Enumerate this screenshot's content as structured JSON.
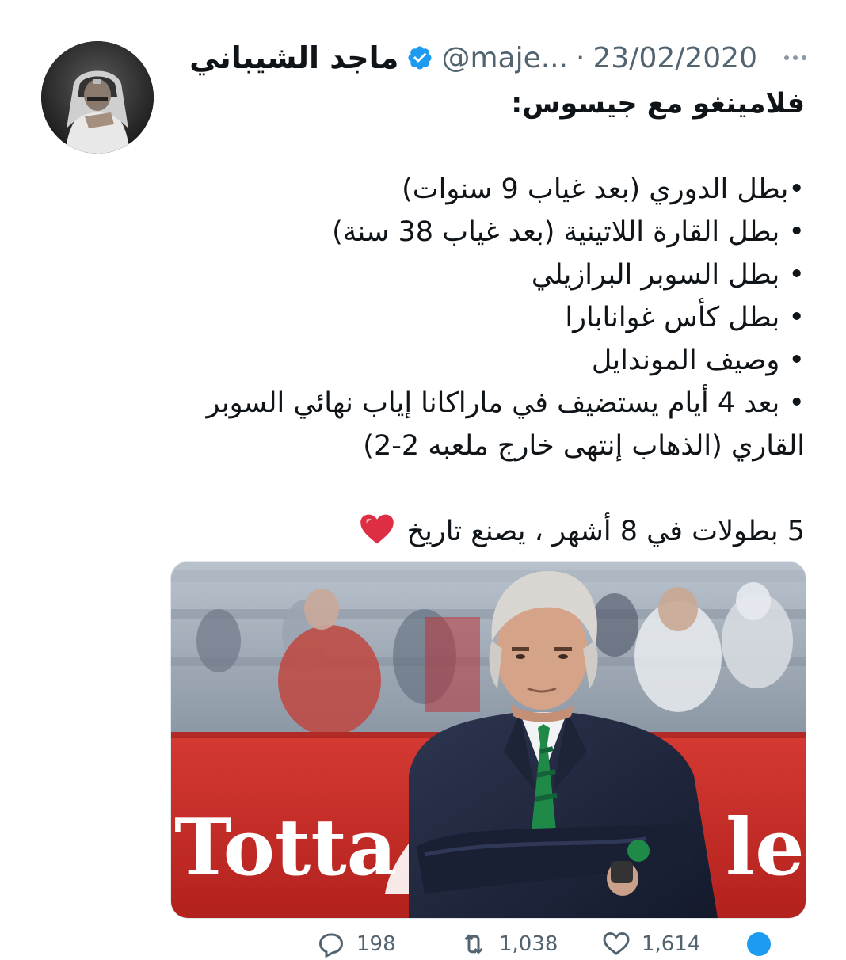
{
  "tweet": {
    "author_name": "ماجد الشيباني",
    "handle": "@maje...",
    "separator": "·",
    "date": "23/02/2020",
    "lines": [
      "فلامينغو مع جيسوس:",
      "•بطل الدوري (بعد غياب 9 سنوات)",
      "• بطل القارة اللاتينية (بعد غياب 38 سنة)",
      "• بطل السوبر البرازيلي",
      "• بطل كأس غوانابارا",
      "• وصيف الموندايل",
      "• بعد 4 أيام يستضيف في ماراكانا إياب نهائي السوبر",
      "القاري (الذهاب إنتهى خارج ملعبه 2-2)",
      "5 بطولات في 8 أشهر ، يصنع تاريخ"
    ],
    "heart_emoji": "heart-emoji"
  },
  "media": {
    "banner_text_left": "Totta",
    "banner_text_right": "ler"
  },
  "actions": {
    "reply_count": "198",
    "retweet_count": "1,038",
    "like_count": "1,614"
  },
  "colors": {
    "verified": "#1d9bf0",
    "secondary_text": "#536471",
    "heart": "#e0245e"
  }
}
